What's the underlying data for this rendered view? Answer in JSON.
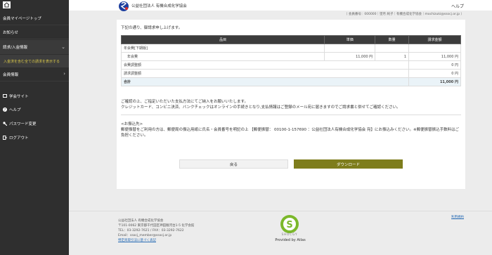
{
  "sidebar": {
    "items": [
      {
        "label": "会員マイページトップ"
      },
      {
        "label": "お知らせ"
      },
      {
        "label": "請求/入金情報"
      },
      {
        "label": "会員情報"
      }
    ],
    "submenu_label": "入金済を含む全ての請求を表示する",
    "links": [
      {
        "label": "学会サイト"
      },
      {
        "label": "ヘルプ"
      },
      {
        "label": "パスワード変更"
      },
      {
        "label": "ログアウト"
      }
    ]
  },
  "header": {
    "org_name": "公益社団法人 有機合成化学協会",
    "help_label": "ヘルプ",
    "user_info": "（ 会員番号：000000｜望月 純子｜有機合成化学協会｜mochizuki@ssocj.or.jp ）"
  },
  "main": {
    "intro": "下記の通り、御請求申し上げます。",
    "table": {
      "headers": [
        "品目",
        "単価",
        "数量",
        "請求金額"
      ],
      "rows": [
        {
          "item": "年会費[下期版]",
          "price": "",
          "qty": "",
          "amount": ""
        },
        {
          "item": "年会費",
          "price": "11,000 円",
          "qty": "1",
          "amount": "11,000 円"
        },
        {
          "item": "会費調整額",
          "price": "",
          "qty": "",
          "amount": "0 円"
        },
        {
          "item": "請求調整額",
          "price": "",
          "qty": "",
          "amount": "0 円"
        }
      ],
      "total_label": "合計",
      "total_amount": "11,000 円"
    },
    "note1_line1": "ご確認の上、ご指定いただいた支払方法にてご納入をお願いいたします。",
    "note1_line2": "クレジットカード、コンビニ決済、バンクチェックはオンラインの手続きとなり,支払情報はご登録のメール宛に届きますのでご請求書と併せてご確認ください。",
    "note2_title": "<お振込先>",
    "note2_text": "郵便振替をご利用の方は、郵便局の振込用紙に氏名・会員番号を明記の上 【郵便振替： 00100-1-157690 ：公益社団法人有機合成化学協会 宛】にお振込みください。※郵便振替振込手数料はご負担ください。",
    "back_button": "戻る",
    "download_button": "ダウンロード"
  },
  "footer": {
    "org": "公益社団法人 有機合成化学協会",
    "address": "〒101-0062 東京都千代田区神田駿河台1-5 化学会館",
    "tel": "TEL：03-3292-7621 / FAX：03-3292-7622",
    "email": "Email：ssocj_member@ssocj.or.jp",
    "law_link": "特定商取引法に基づく表記",
    "policy_link": "利用規約",
    "brand": "SHOCGY",
    "provided_by": "Provided by Atlas"
  },
  "colors": {
    "sidebar_bg": "#2f2f2f",
    "submenu_text": "#d9c84a",
    "table_header": "#3c3c3c",
    "download_button": "#7e7d1c",
    "brand_green": "#7bb82a"
  }
}
